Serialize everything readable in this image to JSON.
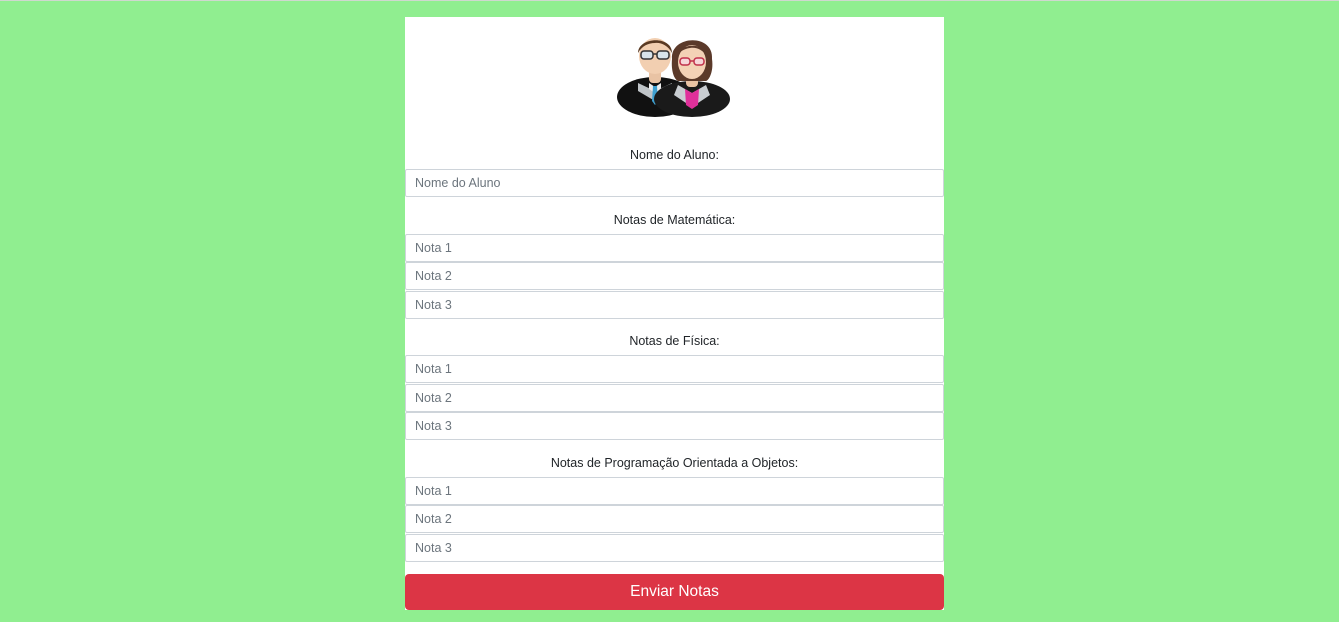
{
  "form": {
    "avatar_icon": "people-icon",
    "student_name": {
      "label": "Nome do Aluno:",
      "placeholder": "Nome do Aluno"
    },
    "sections": [
      {
        "label": "Notas de Matemática:",
        "placeholders": [
          "Nota 1",
          "Nota 2",
          "Nota 3"
        ]
      },
      {
        "label": "Notas de Física:",
        "placeholders": [
          "Nota 1",
          "Nota 2",
          "Nota 3"
        ]
      },
      {
        "label": "Notas de Programação Orientada a Objetos:",
        "placeholders": [
          "Nota 1",
          "Nota 2",
          "Nota 3"
        ]
      }
    ],
    "submit_label": "Enviar Notas"
  },
  "colors": {
    "background": "#90ee90",
    "card": "#ffffff",
    "submit": "#dc3545"
  }
}
